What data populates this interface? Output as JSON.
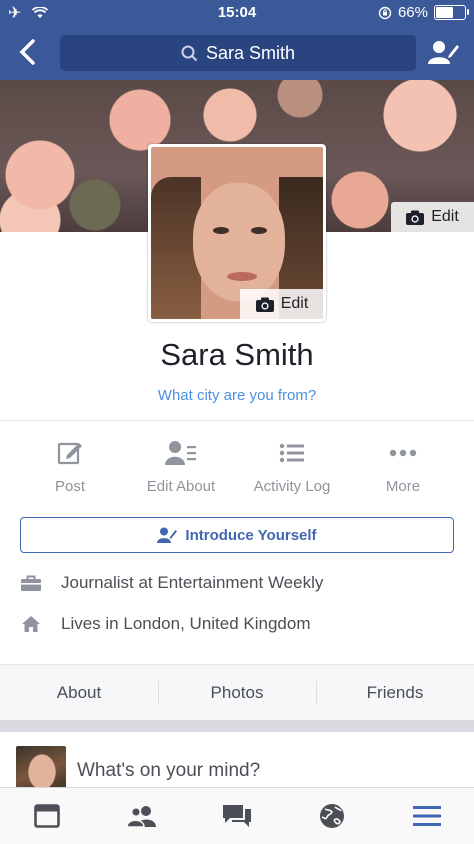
{
  "status_bar": {
    "time": "15:04",
    "battery": "66%",
    "battery_level": 0.66,
    "icons": [
      "airplane-icon",
      "wifi-icon",
      "orientation-lock-icon",
      "battery-icon"
    ]
  },
  "header": {
    "search_text": "Sara Smith",
    "color": "#3b5998"
  },
  "cover": {
    "edit_label": "Edit"
  },
  "profile": {
    "photo_edit_label": "Edit",
    "name": "Sara Smith",
    "city_prompt": "What city are you from?"
  },
  "actions": [
    {
      "label": "Post",
      "icon": "edit-icon"
    },
    {
      "label": "Edit About",
      "icon": "profile-card-icon"
    },
    {
      "label": "Activity Log",
      "icon": "list-icon"
    },
    {
      "label": "More",
      "icon": "more-dots-icon"
    }
  ],
  "introduce": {
    "label": "Introduce Yourself",
    "color": "#4267b2"
  },
  "info": [
    {
      "text": "Journalist at Entertainment Weekly",
      "icon": "briefcase-icon"
    },
    {
      "text": "Lives in London, United Kingdom",
      "icon": "home-icon"
    }
  ],
  "tabs": [
    "About",
    "Photos",
    "Friends"
  ],
  "composer": {
    "prompt": "What's on your mind?"
  },
  "bottom_nav": {
    "items": [
      "news-feed-icon",
      "friends-icon",
      "messages-icon",
      "globe-icon",
      "menu-icon"
    ],
    "active_color": "#4267b2"
  }
}
